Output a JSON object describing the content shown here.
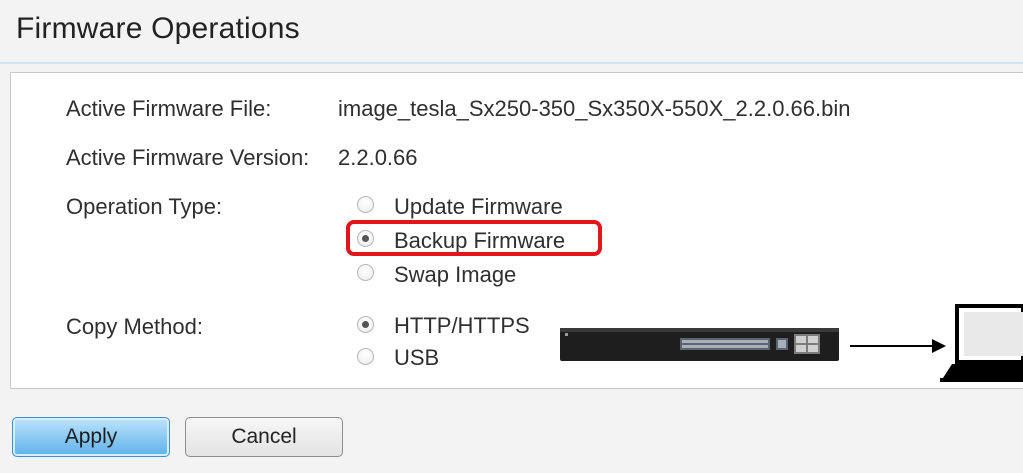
{
  "page": {
    "title": "Firmware Operations"
  },
  "fields": {
    "active_file_label": "Active Firmware File:",
    "active_file_value": "image_tesla_Sx250-350_Sx350X-550X_2.2.0.66.bin",
    "active_version_label": "Active Firmware Version:",
    "active_version_value": "2.2.0.66"
  },
  "operation_type": {
    "label": "Operation Type:",
    "options": [
      {
        "label": "Update Firmware",
        "checked": false
      },
      {
        "label": "Backup Firmware",
        "checked": true
      },
      {
        "label": "Swap Image",
        "checked": false
      }
    ]
  },
  "copy_method": {
    "label": "Copy Method:",
    "options": [
      {
        "label": "HTTP/HTTPS",
        "checked": true
      },
      {
        "label": "USB",
        "checked": false
      }
    ]
  },
  "buttons": {
    "apply": "Apply",
    "cancel": "Cancel"
  },
  "colors": {
    "highlight": "#e4141b",
    "apply_button": "#8ccaf3"
  },
  "illustration": {
    "icons": [
      "network-switch-icon",
      "arrow-right-icon",
      "laptop-icon"
    ]
  }
}
